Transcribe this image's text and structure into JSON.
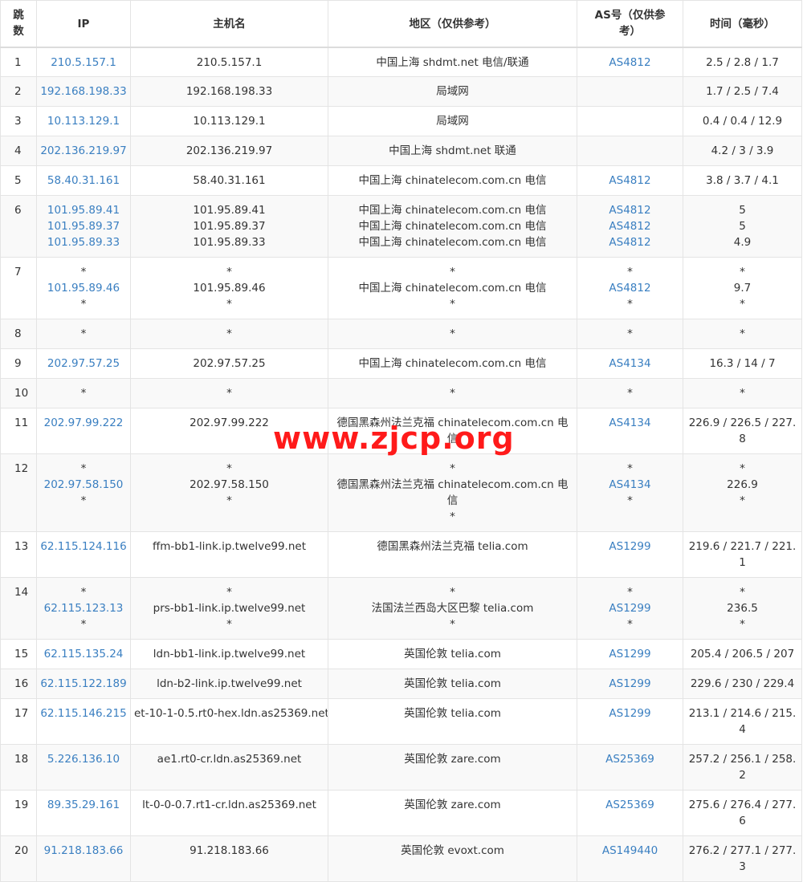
{
  "headers": {
    "hop": "跳数",
    "ip": "IP",
    "host": "主机名",
    "region": "地区（仅供参考）",
    "as": "AS号（仅供参考）",
    "time": "时间（毫秒）"
  },
  "rows": [
    {
      "hop": "1",
      "ip": [
        "210.5.157.1"
      ],
      "host": [
        "210.5.157.1"
      ],
      "region": [
        "中国上海 shdmt.net 电信/联通"
      ],
      "as": [
        "AS4812"
      ],
      "time": [
        "2.5 / 2.8 / 1.7"
      ]
    },
    {
      "hop": "2",
      "ip": [
        "192.168.198.33"
      ],
      "host": [
        "192.168.198.33"
      ],
      "region": [
        "局域网"
      ],
      "as": [
        ""
      ],
      "time": [
        "1.7 / 2.5 / 7.4"
      ]
    },
    {
      "hop": "3",
      "ip": [
        "10.113.129.1"
      ],
      "host": [
        "10.113.129.1"
      ],
      "region": [
        "局域网"
      ],
      "as": [
        ""
      ],
      "time": [
        "0.4 / 0.4 / 12.9"
      ]
    },
    {
      "hop": "4",
      "ip": [
        "202.136.219.97"
      ],
      "host": [
        "202.136.219.97"
      ],
      "region": [
        "中国上海 shdmt.net 联通"
      ],
      "as": [
        ""
      ],
      "time": [
        "4.2 / 3 / 3.9"
      ]
    },
    {
      "hop": "5",
      "ip": [
        "58.40.31.161"
      ],
      "host": [
        "58.40.31.161"
      ],
      "region": [
        "中国上海 chinatelecom.com.cn 电信"
      ],
      "as": [
        "AS4812"
      ],
      "time": [
        "3.8 / 3.7 / 4.1"
      ]
    },
    {
      "hop": "6",
      "ip": [
        "101.95.89.41",
        "101.95.89.37",
        "101.95.89.33"
      ],
      "host": [
        "101.95.89.41",
        "101.95.89.37",
        "101.95.89.33"
      ],
      "region": [
        "中国上海 chinatelecom.com.cn 电信",
        "中国上海 chinatelecom.com.cn 电信",
        "中国上海 chinatelecom.com.cn 电信"
      ],
      "as": [
        "AS4812",
        "AS4812",
        "AS4812"
      ],
      "time": [
        "5",
        "5",
        "4.9"
      ]
    },
    {
      "hop": "7",
      "ip": [
        "*",
        "101.95.89.46",
        "*"
      ],
      "host": [
        "*",
        "101.95.89.46",
        "*"
      ],
      "region": [
        "*",
        "中国上海 chinatelecom.com.cn 电信",
        "*"
      ],
      "as": [
        "*",
        "AS4812",
        "*"
      ],
      "time": [
        "*",
        "9.7",
        "*"
      ]
    },
    {
      "hop": "8",
      "ip": [
        "*"
      ],
      "host": [
        "*"
      ],
      "region": [
        "*"
      ],
      "as": [
        "*"
      ],
      "time": [
        "*"
      ]
    },
    {
      "hop": "9",
      "ip": [
        "202.97.57.25"
      ],
      "host": [
        "202.97.57.25"
      ],
      "region": [
        "中国上海 chinatelecom.com.cn 电信"
      ],
      "as": [
        "AS4134"
      ],
      "time": [
        "16.3 / 14 / 7"
      ]
    },
    {
      "hop": "10",
      "ip": [
        "*"
      ],
      "host": [
        "*"
      ],
      "region": [
        "*"
      ],
      "as": [
        "*"
      ],
      "time": [
        "*"
      ]
    },
    {
      "hop": "11",
      "ip": [
        "202.97.99.222"
      ],
      "host": [
        "202.97.99.222"
      ],
      "region": [
        "德国黑森州法兰克福 chinatelecom.com.cn 电信"
      ],
      "as": [
        "AS4134"
      ],
      "time": [
        "226.9 / 226.5 / 227.8"
      ]
    },
    {
      "hop": "12",
      "ip": [
        "*",
        "202.97.58.150",
        "*"
      ],
      "host": [
        "*",
        "202.97.58.150",
        "*"
      ],
      "region": [
        "*",
        "德国黑森州法兰克福 chinatelecom.com.cn 电信",
        "*"
      ],
      "as": [
        "*",
        "AS4134",
        "*"
      ],
      "time": [
        "*",
        "226.9",
        "*"
      ]
    },
    {
      "hop": "13",
      "ip": [
        "62.115.124.116"
      ],
      "host": [
        "ffm-bb1-link.ip.twelve99.net"
      ],
      "region": [
        "德国黑森州法兰克福 telia.com"
      ],
      "as": [
        "AS1299"
      ],
      "time": [
        "219.6 / 221.7 / 221.1"
      ]
    },
    {
      "hop": "14",
      "ip": [
        "*",
        "62.115.123.13",
        "*"
      ],
      "host": [
        "*",
        "prs-bb1-link.ip.twelve99.net",
        "*"
      ],
      "region": [
        "*",
        "法国法兰西岛大区巴黎 telia.com",
        "*"
      ],
      "as": [
        "*",
        "AS1299",
        "*"
      ],
      "time": [
        "*",
        "236.5",
        "*"
      ]
    },
    {
      "hop": "15",
      "ip": [
        "62.115.135.24"
      ],
      "host": [
        "ldn-bb1-link.ip.twelve99.net"
      ],
      "region": [
        "英国伦敦 telia.com"
      ],
      "as": [
        "AS1299"
      ],
      "time": [
        "205.4 / 206.5 / 207"
      ]
    },
    {
      "hop": "16",
      "ip": [
        "62.115.122.189"
      ],
      "host": [
        "ldn-b2-link.ip.twelve99.net"
      ],
      "region": [
        "英国伦敦 telia.com"
      ],
      "as": [
        "AS1299"
      ],
      "time": [
        "229.6 / 230 / 229.4"
      ]
    },
    {
      "hop": "17",
      "ip": [
        "62.115.146.215"
      ],
      "host": [
        "et-10-1-0.5.rt0-hex.ldn.as25369.net"
      ],
      "region": [
        "英国伦敦 telia.com"
      ],
      "as": [
        "AS1299"
      ],
      "time": [
        "213.1 / 214.6 / 215.4"
      ]
    },
    {
      "hop": "18",
      "ip": [
        "5.226.136.10"
      ],
      "host": [
        "ae1.rt0-cr.ldn.as25369.net"
      ],
      "region": [
        "英国伦敦 zare.com"
      ],
      "as": [
        "AS25369"
      ],
      "time": [
        "257.2 / 256.1 / 258.2"
      ]
    },
    {
      "hop": "19",
      "ip": [
        "89.35.29.161"
      ],
      "host": [
        "lt-0-0-0.7.rt1-cr.ldn.as25369.net"
      ],
      "region": [
        "英国伦敦 zare.com"
      ],
      "as": [
        "AS25369"
      ],
      "time": [
        "275.6 / 276.4 / 277.6"
      ]
    },
    {
      "hop": "20",
      "ip": [
        "91.218.183.66"
      ],
      "host": [
        "91.218.183.66"
      ],
      "region": [
        "英国伦敦 evoxt.com"
      ],
      "as": [
        "AS149440"
      ],
      "time": [
        "276.2 / 277.1 / 277.3"
      ]
    }
  ],
  "watermark": "www.zjcp.org",
  "colors": {
    "link": "#3a7fc1",
    "watermark": "#ff1a1a",
    "border": "#e4e4e4",
    "stripe": "#f9f9f9"
  }
}
